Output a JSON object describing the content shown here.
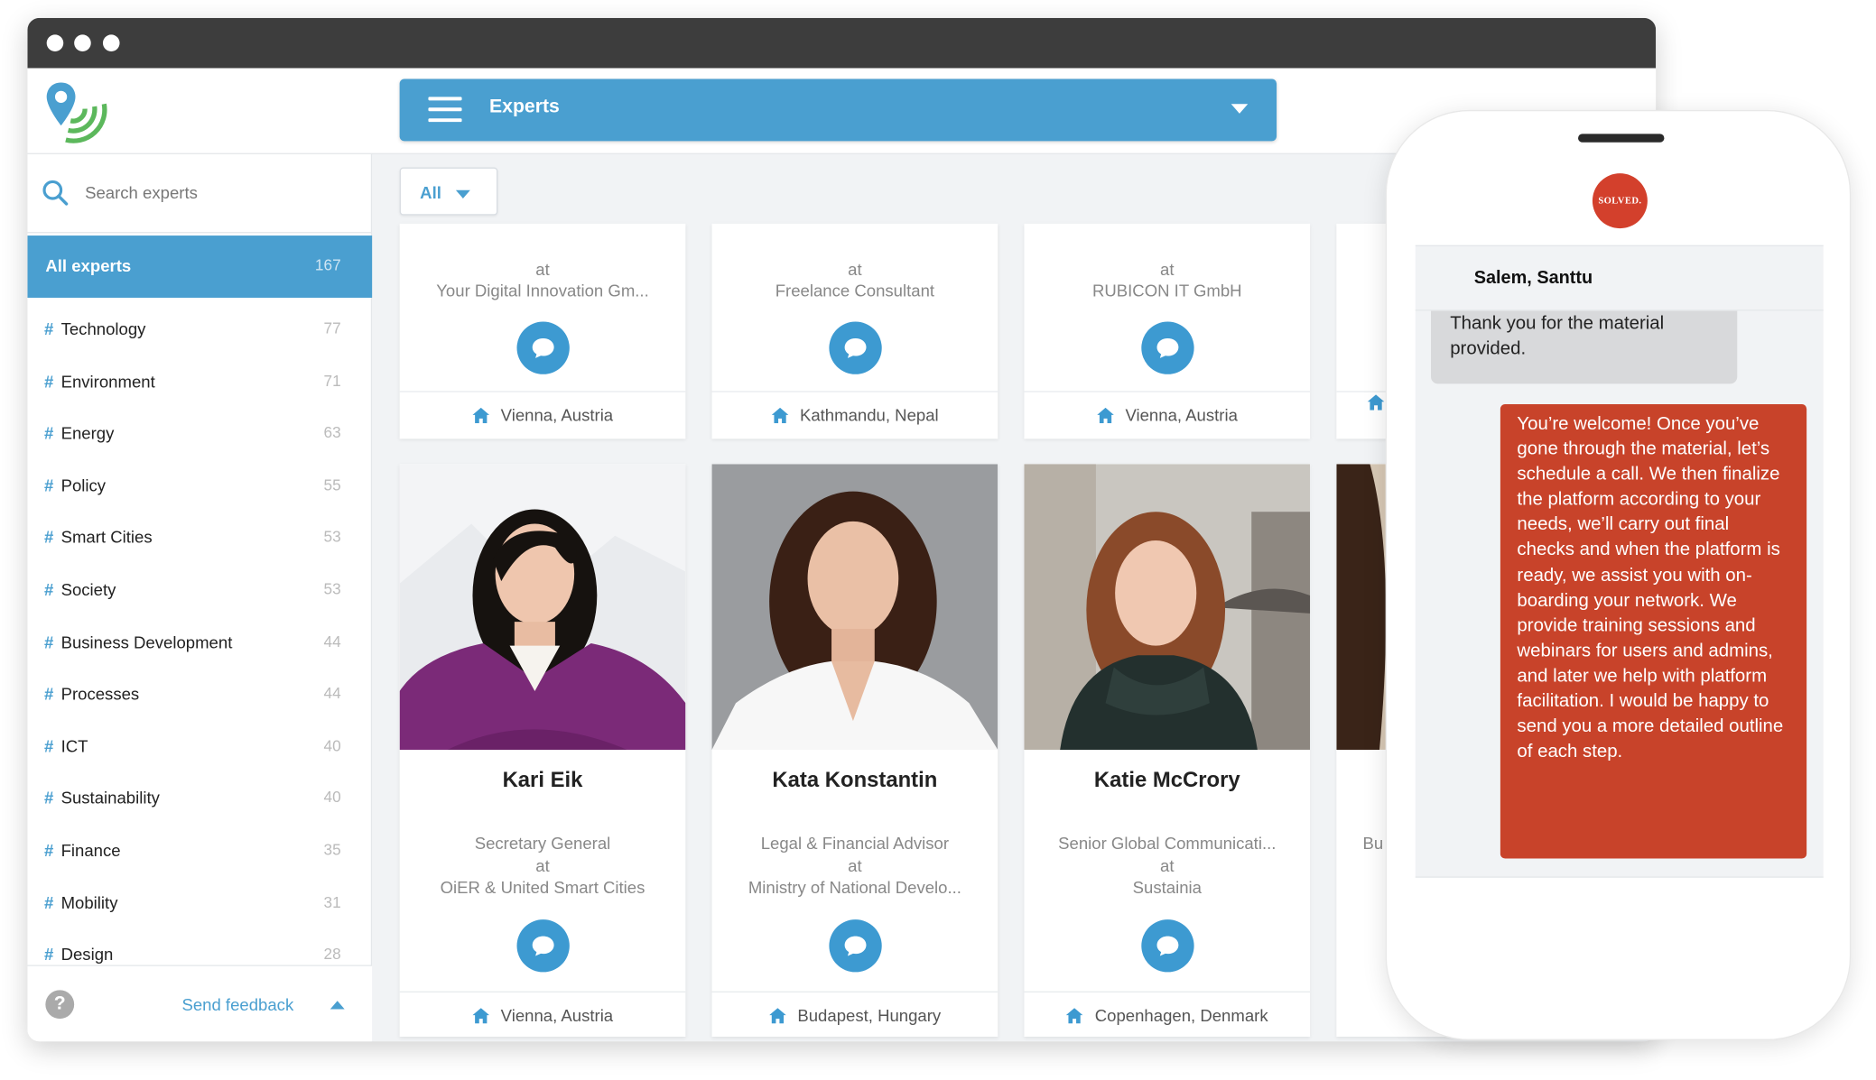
{
  "app": {
    "section_title": "Experts"
  },
  "sidebar": {
    "search_placeholder": "Search experts",
    "all_experts": {
      "label": "All experts",
      "count": "167"
    },
    "categories": [
      {
        "name": "Technology",
        "count": "77"
      },
      {
        "name": "Environment",
        "count": "71"
      },
      {
        "name": "Energy",
        "count": "63"
      },
      {
        "name": "Policy",
        "count": "55"
      },
      {
        "name": "Smart Cities",
        "count": "53"
      },
      {
        "name": "Society",
        "count": "53"
      },
      {
        "name": "Business Development",
        "count": "44"
      },
      {
        "name": "Processes",
        "count": "44"
      },
      {
        "name": "ICT",
        "count": "40"
      },
      {
        "name": "Sustainability",
        "count": "40"
      },
      {
        "name": "Finance",
        "count": "35"
      },
      {
        "name": "Mobility",
        "count": "31"
      },
      {
        "name": "Design",
        "count": "28"
      }
    ],
    "feedback_label": "Send feedback",
    "help_glyph": "?"
  },
  "filter": {
    "label": "All"
  },
  "cards_top": [
    {
      "at": "at",
      "org": "Your Digital Innovation Gm...",
      "location": "Vienna, Austria"
    },
    {
      "at": "at",
      "org": "Freelance Consultant",
      "location": "Kathmandu, Nepal"
    },
    {
      "at": "at",
      "org": "RUBICON IT GmbH",
      "location": "Vienna, Austria"
    },
    {
      "at": "",
      "org": "",
      "location": ""
    }
  ],
  "cards_bottom": [
    {
      "name": "Kari Eik",
      "role": "Secretary General",
      "at": "at",
      "org": "OiER & United Smart Cities",
      "location": "Vienna, Austria"
    },
    {
      "name": "Kata Konstantin",
      "role": "Legal & Financial Advisor",
      "at": "at",
      "org": "Ministry of National Develo...",
      "location": "Budapest, Hungary"
    },
    {
      "name": "Katie McCrory",
      "role": "Senior Global Communicati...",
      "at": "at",
      "org": "Sustainia",
      "location": "Copenhagen, Denmark"
    },
    {
      "name": "",
      "role": "Bu",
      "at": "",
      "org": "",
      "location": ""
    }
  ],
  "phone": {
    "logo_text": "SOLVED.",
    "contact": "Salem, Santtu",
    "incoming_message": "Thank you for the material provided.",
    "outgoing_message": "You’re welcome! Once you’ve gone through the material, let’s schedule a call. We then finalize the platform according to your needs, we’ll carry out final checks and when the platform is ready, we assist you with on-boarding your network. We provide training sessions and webinars for users and admins, and later we help with platform facilitation. I would be happy to send you a more detailed outline of each step."
  },
  "icons": {
    "search": "search-icon",
    "menu": "hamburger-menu-icon",
    "chat": "chat-bubble-icon",
    "home": "home-icon",
    "help": "help-icon"
  },
  "colors": {
    "accent": "#4a9fd0",
    "solved_red": "#c8432a",
    "titlebar": "#3d3d3d"
  }
}
